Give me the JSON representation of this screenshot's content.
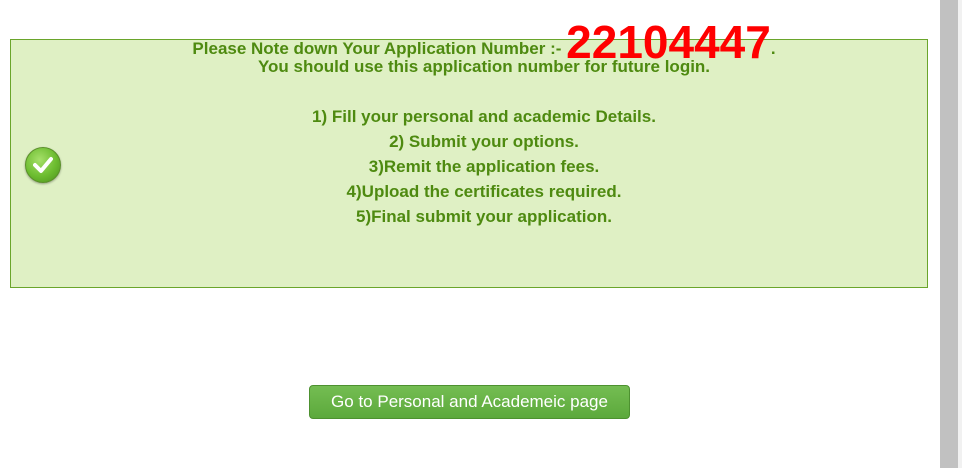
{
  "notice": {
    "app_prefix": "Please Note down Your Application Number :- ",
    "app_number": "22104447",
    "app_suffix": ".",
    "line2": "You should use this application number for future login.",
    "steps": [
      "1) Fill your personal and academic Details.",
      "2) Submit your options.",
      "3)Remit the application fees.",
      "4)Upload the certificates required.",
      "5)Final submit your application."
    ],
    "icon": "check-circle-icon"
  },
  "actions": {
    "go_button_label": "Go to Personal and Academeic page"
  },
  "colors": {
    "box_background": "#dff0c4",
    "box_border": "#6aa52b",
    "text_green": "#4e8a10",
    "app_number_red": "#ff0000",
    "button_green": "#5ca93c"
  }
}
